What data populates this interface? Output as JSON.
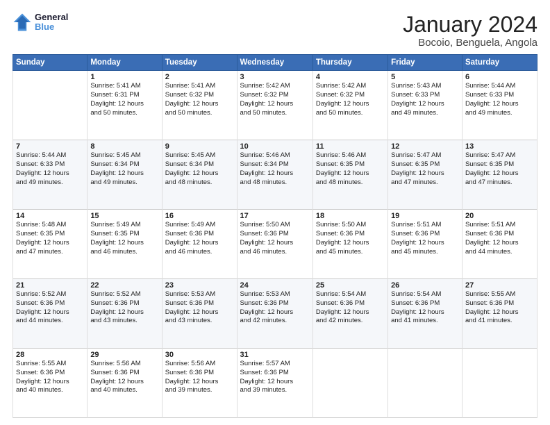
{
  "header": {
    "logo_general": "General",
    "logo_blue": "Blue",
    "title": "January 2024",
    "subtitle": "Bocoio, Benguela, Angola"
  },
  "columns": [
    "Sunday",
    "Monday",
    "Tuesday",
    "Wednesday",
    "Thursday",
    "Friday",
    "Saturday"
  ],
  "weeks": [
    {
      "cells": [
        {
          "day": "",
          "content": ""
        },
        {
          "day": "1",
          "content": "Sunrise: 5:41 AM\nSunset: 6:31 PM\nDaylight: 12 hours\nand 50 minutes."
        },
        {
          "day": "2",
          "content": "Sunrise: 5:41 AM\nSunset: 6:32 PM\nDaylight: 12 hours\nand 50 minutes."
        },
        {
          "day": "3",
          "content": "Sunrise: 5:42 AM\nSunset: 6:32 PM\nDaylight: 12 hours\nand 50 minutes."
        },
        {
          "day": "4",
          "content": "Sunrise: 5:42 AM\nSunset: 6:32 PM\nDaylight: 12 hours\nand 50 minutes."
        },
        {
          "day": "5",
          "content": "Sunrise: 5:43 AM\nSunset: 6:33 PM\nDaylight: 12 hours\nand 49 minutes."
        },
        {
          "day": "6",
          "content": "Sunrise: 5:44 AM\nSunset: 6:33 PM\nDaylight: 12 hours\nand 49 minutes."
        }
      ]
    },
    {
      "cells": [
        {
          "day": "7",
          "content": "Sunrise: 5:44 AM\nSunset: 6:33 PM\nDaylight: 12 hours\nand 49 minutes."
        },
        {
          "day": "8",
          "content": "Sunrise: 5:45 AM\nSunset: 6:34 PM\nDaylight: 12 hours\nand 49 minutes."
        },
        {
          "day": "9",
          "content": "Sunrise: 5:45 AM\nSunset: 6:34 PM\nDaylight: 12 hours\nand 48 minutes."
        },
        {
          "day": "10",
          "content": "Sunrise: 5:46 AM\nSunset: 6:34 PM\nDaylight: 12 hours\nand 48 minutes."
        },
        {
          "day": "11",
          "content": "Sunrise: 5:46 AM\nSunset: 6:35 PM\nDaylight: 12 hours\nand 48 minutes."
        },
        {
          "day": "12",
          "content": "Sunrise: 5:47 AM\nSunset: 6:35 PM\nDaylight: 12 hours\nand 47 minutes."
        },
        {
          "day": "13",
          "content": "Sunrise: 5:47 AM\nSunset: 6:35 PM\nDaylight: 12 hours\nand 47 minutes."
        }
      ]
    },
    {
      "cells": [
        {
          "day": "14",
          "content": "Sunrise: 5:48 AM\nSunset: 6:35 PM\nDaylight: 12 hours\nand 47 minutes."
        },
        {
          "day": "15",
          "content": "Sunrise: 5:49 AM\nSunset: 6:35 PM\nDaylight: 12 hours\nand 46 minutes."
        },
        {
          "day": "16",
          "content": "Sunrise: 5:49 AM\nSunset: 6:36 PM\nDaylight: 12 hours\nand 46 minutes."
        },
        {
          "day": "17",
          "content": "Sunrise: 5:50 AM\nSunset: 6:36 PM\nDaylight: 12 hours\nand 46 minutes."
        },
        {
          "day": "18",
          "content": "Sunrise: 5:50 AM\nSunset: 6:36 PM\nDaylight: 12 hours\nand 45 minutes."
        },
        {
          "day": "19",
          "content": "Sunrise: 5:51 AM\nSunset: 6:36 PM\nDaylight: 12 hours\nand 45 minutes."
        },
        {
          "day": "20",
          "content": "Sunrise: 5:51 AM\nSunset: 6:36 PM\nDaylight: 12 hours\nand 44 minutes."
        }
      ]
    },
    {
      "cells": [
        {
          "day": "21",
          "content": "Sunrise: 5:52 AM\nSunset: 6:36 PM\nDaylight: 12 hours\nand 44 minutes."
        },
        {
          "day": "22",
          "content": "Sunrise: 5:52 AM\nSunset: 6:36 PM\nDaylight: 12 hours\nand 43 minutes."
        },
        {
          "day": "23",
          "content": "Sunrise: 5:53 AM\nSunset: 6:36 PM\nDaylight: 12 hours\nand 43 minutes."
        },
        {
          "day": "24",
          "content": "Sunrise: 5:53 AM\nSunset: 6:36 PM\nDaylight: 12 hours\nand 42 minutes."
        },
        {
          "day": "25",
          "content": "Sunrise: 5:54 AM\nSunset: 6:36 PM\nDaylight: 12 hours\nand 42 minutes."
        },
        {
          "day": "26",
          "content": "Sunrise: 5:54 AM\nSunset: 6:36 PM\nDaylight: 12 hours\nand 41 minutes."
        },
        {
          "day": "27",
          "content": "Sunrise: 5:55 AM\nSunset: 6:36 PM\nDaylight: 12 hours\nand 41 minutes."
        }
      ]
    },
    {
      "cells": [
        {
          "day": "28",
          "content": "Sunrise: 5:55 AM\nSunset: 6:36 PM\nDaylight: 12 hours\nand 40 minutes."
        },
        {
          "day": "29",
          "content": "Sunrise: 5:56 AM\nSunset: 6:36 PM\nDaylight: 12 hours\nand 40 minutes."
        },
        {
          "day": "30",
          "content": "Sunrise: 5:56 AM\nSunset: 6:36 PM\nDaylight: 12 hours\nand 39 minutes."
        },
        {
          "day": "31",
          "content": "Sunrise: 5:57 AM\nSunset: 6:36 PM\nDaylight: 12 hours\nand 39 minutes."
        },
        {
          "day": "",
          "content": ""
        },
        {
          "day": "",
          "content": ""
        },
        {
          "day": "",
          "content": ""
        }
      ]
    }
  ]
}
